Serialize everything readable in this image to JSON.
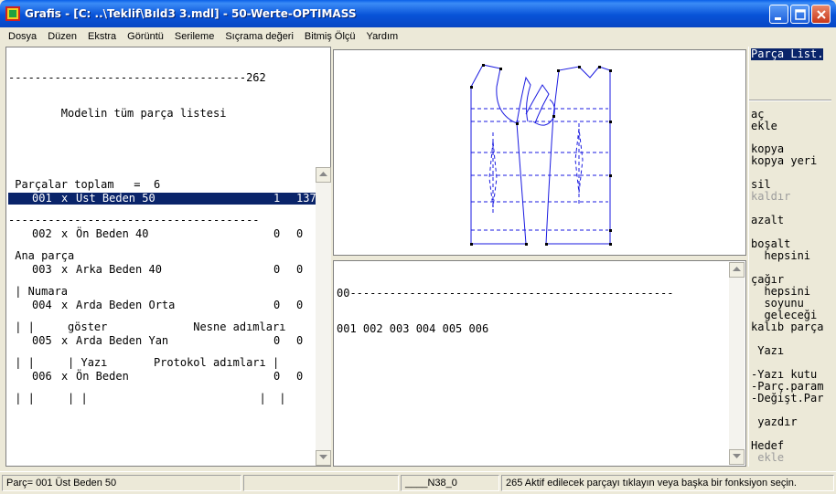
{
  "window": {
    "title": "Grafis - [C: ..\\Teklif\\Bıld3 3.mdl] - 50-Werte-OPTIMASS"
  },
  "menu": [
    "Dosya",
    "Düzen",
    "Ekstra",
    "Görüntü",
    "Serileme",
    "Sıçrama değeri",
    "Bitmiş Ölçü",
    "Yardım"
  ],
  "parts_panel": {
    "header_lines": [
      "------------------------------------262",
      "        Modelin tüm parça listesi",
      "",
      " Parçalar toplam   =  6",
      "--------------------------------------",
      " Ana parça",
      " | Numara",
      " | |     göster             Nesne adımları",
      " | |     | Yazı       Protokol adımları |",
      " | |     | |                          |  |"
    ],
    "rows": [
      {
        "num": "001",
        "show": "x",
        "name": "Üst Beden 50",
        "a": "1",
        "b": "137"
      },
      {
        "num": "002",
        "show": "x",
        "name": "Ön Beden 40",
        "a": "0",
        "b": "0"
      },
      {
        "num": "003",
        "show": "x",
        "name": "Arka Beden 40",
        "a": "0",
        "b": "0"
      },
      {
        "num": "004",
        "show": "x",
        "name": "Arda Beden Orta",
        "a": "0",
        "b": "0"
      },
      {
        "num": "005",
        "show": "x",
        "name": "Arda Beden Yan",
        "a": "0",
        "b": "0"
      },
      {
        "num": "006",
        "show": "x",
        "name": "Ön Beden",
        "a": "0",
        "b": "0"
      }
    ]
  },
  "console": {
    "line1": "00-------------------------------------------------",
    "line2": "001 002 003 004 005 006"
  },
  "commands": {
    "parca_list": "Parça List.",
    "ac": "aç",
    "ekle": "ekle",
    "kopya": "kopya",
    "kopya_yeri": "kopya yeri",
    "sil": "sil",
    "kaldir": "kaldır",
    "azalt": "azalt",
    "bosalt": "boşalt",
    "hepsini1": "  hepsini",
    "cagir": "çağır",
    "hepsini2": "  hepsini",
    "soyunu": "  soyunu",
    "gelecegi": "  geleceği",
    "kalib_parca": "kalıb parça",
    "yazi": " Yazı",
    "yazi_kutu": "-Yazı kutu",
    "parc_param": "-Parç.param",
    "degist_par": "-Değişt.Par",
    "yazdir": " yazdır",
    "hedef": "Hedef",
    "ekle2": " ekle"
  },
  "status": {
    "part": "Parç= 001  Üst Beden 50",
    "empty": "",
    "code": "____N38_0",
    "message": "265 Aktif edilecek parçayı tıklayın veya başka bir fonksiyon seçin."
  },
  "colors": {
    "selection": "#0A246A",
    "pattern_line": "#1A1AE0"
  }
}
